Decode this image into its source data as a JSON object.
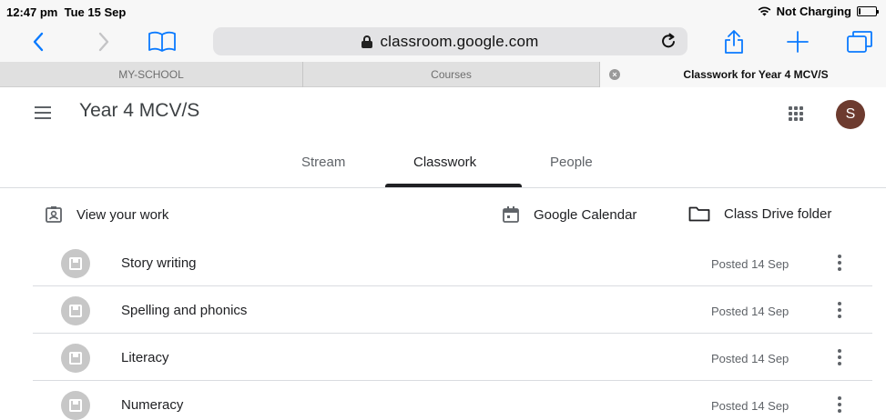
{
  "status_bar": {
    "time": "12:47 pm",
    "date": "Tue 15 Sep",
    "charging": "Not Charging",
    "battery_level": 0.1
  },
  "browser": {
    "url": "classroom.google.com",
    "tabs": [
      {
        "label": "MY-SCHOOL",
        "active": false
      },
      {
        "label": "Courses",
        "active": false
      },
      {
        "label": "Classwork for Year 4 MCV/S",
        "active": true
      }
    ],
    "accent_color": "#0a7aff"
  },
  "header": {
    "class_name": "Year 4 MCV/S",
    "avatar_letter": "S",
    "avatar_color": "#6d3b2f"
  },
  "class_tabs": [
    {
      "label": "Stream",
      "active": false
    },
    {
      "label": "Classwork",
      "active": true
    },
    {
      "label": "People",
      "active": false
    }
  ],
  "actions": {
    "view_work": "View your work",
    "calendar": "Google Calendar",
    "drive": "Class Drive folder"
  },
  "topics": [
    {
      "title": "Story writing",
      "posted": "Posted 14 Sep"
    },
    {
      "title": "Spelling and phonics",
      "posted": "Posted 14 Sep"
    },
    {
      "title": "Literacy",
      "posted": "Posted 14 Sep"
    },
    {
      "title": "Numeracy",
      "posted": "Posted 14 Sep"
    }
  ]
}
